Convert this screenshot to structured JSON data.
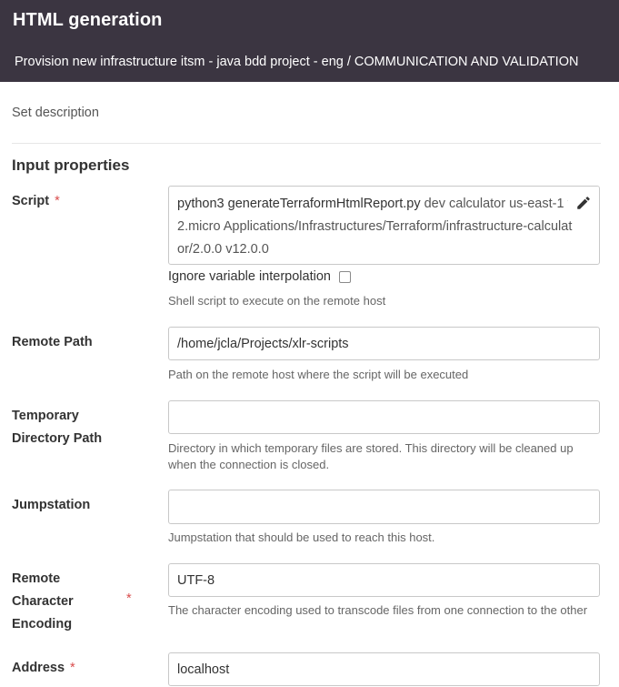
{
  "header": {
    "title": "HTML generation",
    "subtitle": "Provision new infrastructure itsm - java bdd project - eng / COMMUNICATION AND VALIDATION"
  },
  "description_link": "Set description",
  "section_title": "Input properties",
  "required_marker": "*",
  "script": {
    "label": "Script",
    "command": "python3 generateTerraformHtmlReport.py",
    "args": " dev calculator us-east-1 t2.micro Applications/Infrastructures/Terraform/infrastructure-calculator/2.0.0 v12.0.0",
    "edit_icon": "pencil-icon",
    "ignore_interpolation_label": "Ignore variable interpolation",
    "ignore_interpolation_checked": false,
    "help": "Shell script to execute on the remote host"
  },
  "remote_path": {
    "label": "Remote Path",
    "value": "/home/jcla/Projects/xlr-scripts",
    "help": "Path on the remote host where the script will be executed"
  },
  "temp_dir": {
    "label_line1": "Temporary",
    "label_line2": "Directory Path",
    "value": "",
    "help": "Directory in which temporary files are stored. This directory will be cleaned up when the connection is closed."
  },
  "jumpstation": {
    "label": "Jumpstation",
    "value": "",
    "help": "Jumpstation that should be used to reach this host."
  },
  "encoding": {
    "label_line1": "Remote",
    "label_line2": "Character",
    "label_line3": "Encoding",
    "value": "UTF-8",
    "help": "The character encoding used to transcode files from one connection to the other"
  },
  "address": {
    "label": "Address",
    "value": "localhost"
  }
}
